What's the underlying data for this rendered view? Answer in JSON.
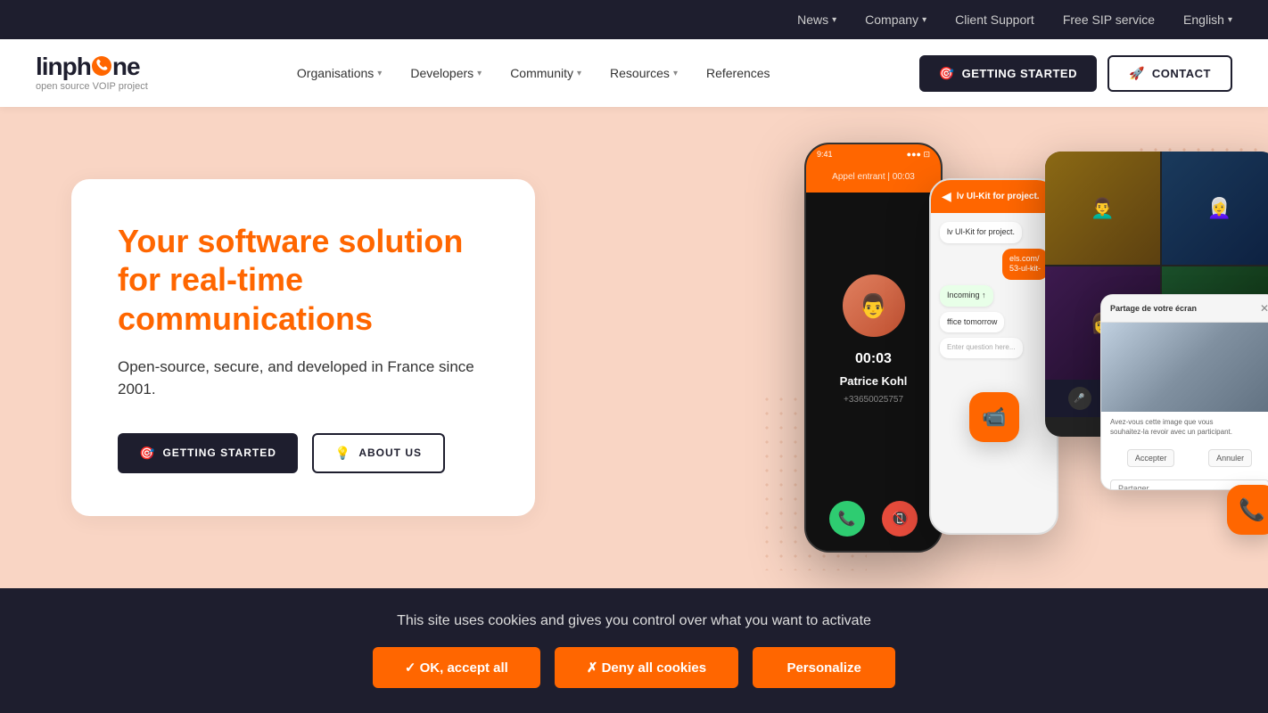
{
  "topbar": {
    "nav_items": [
      {
        "label": "News",
        "has_dropdown": true
      },
      {
        "label": "Company",
        "has_dropdown": true
      },
      {
        "label": "Client Support",
        "has_dropdown": false
      },
      {
        "label": "Free SIP service",
        "has_dropdown": false
      },
      {
        "label": "English",
        "has_dropdown": true
      }
    ]
  },
  "nav": {
    "logo": {
      "brand": "linph",
      "brand_suffix": "ne",
      "tagline": "open source VOIP project"
    },
    "links": [
      {
        "label": "Organisations",
        "has_dropdown": true
      },
      {
        "label": "Developers",
        "has_dropdown": true
      },
      {
        "label": "Community",
        "has_dropdown": true
      },
      {
        "label": "Resources",
        "has_dropdown": true
      },
      {
        "label": "References",
        "has_dropdown": false
      }
    ],
    "btn_getting_started": "GETTING STARTED",
    "btn_contact": "CONTACT"
  },
  "hero": {
    "title": "Your software solution for real-time communications",
    "subtitle": "Open-source, secure, and developed in France since 2001.",
    "btn_getting_started": "GETTING STARTED",
    "btn_about": "ABOUT US"
  },
  "phone_mockup": {
    "call_label": "Appel entrant | 00:03",
    "call_timer": "00:03",
    "caller_name": "Patrice Kohl",
    "caller_number": "+33650025757"
  },
  "cookie": {
    "message": "This site uses cookies and gives you control over what you want to activate",
    "btn_accept": "✓ OK, accept all",
    "btn_deny": "✗ Deny all cookies",
    "btn_personalize": "Personalize"
  }
}
